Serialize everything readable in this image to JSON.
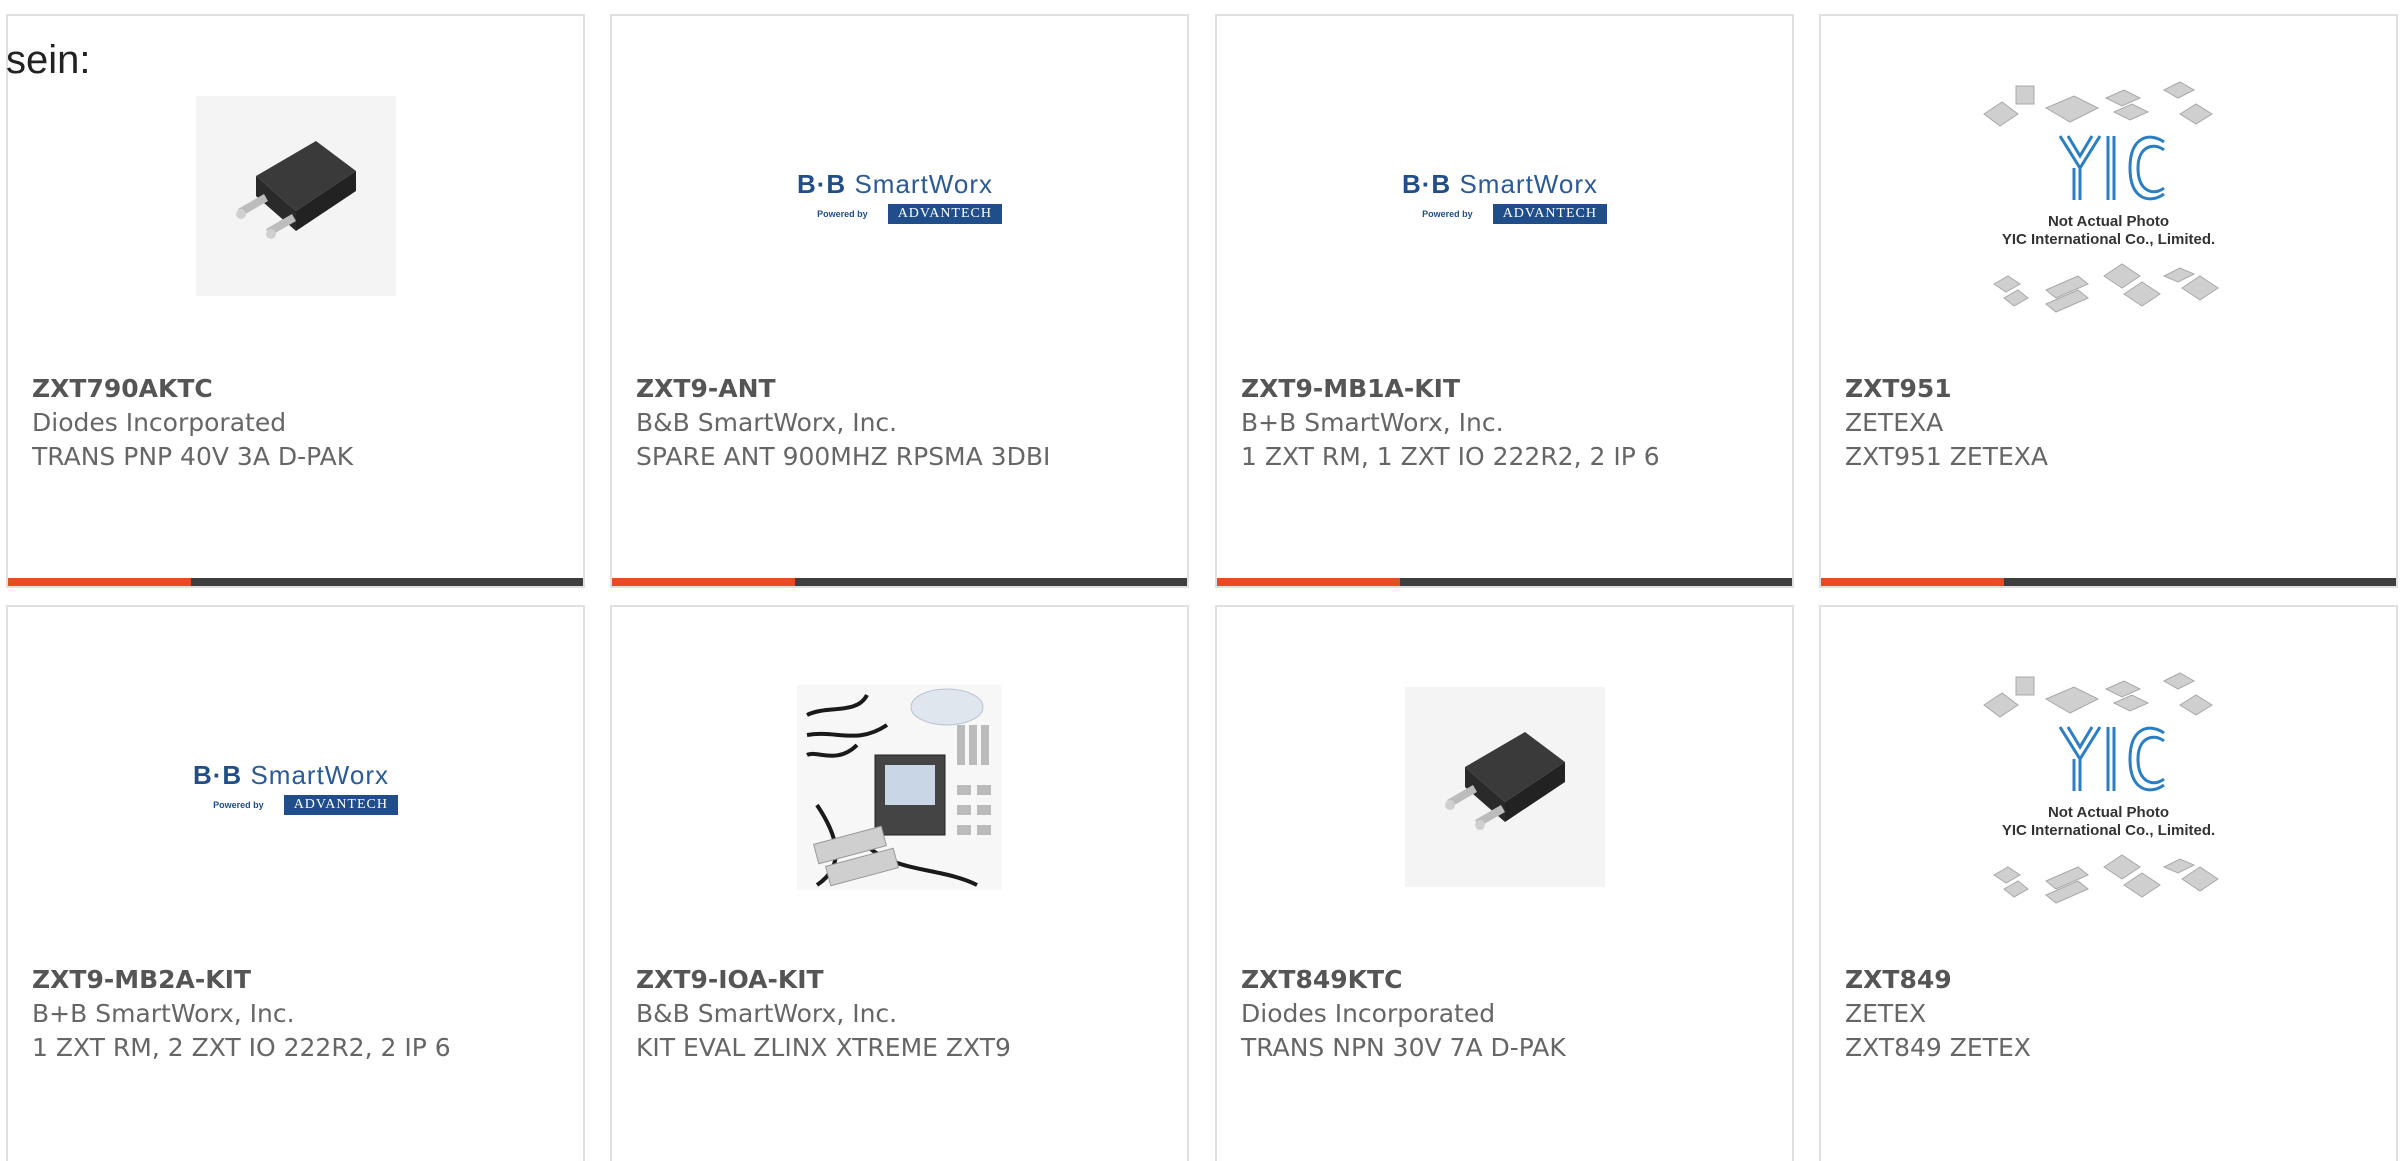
{
  "lead_text": "sein:",
  "products": [
    {
      "part_number": "ZXT790AKTC",
      "manufacturer": "Diodes Incorporated",
      "description": "TRANS PNP 40V 3A D-PAK",
      "image": "dpak-transistor-icon",
      "has_accent_bar": true
    },
    {
      "part_number": "ZXT9-ANT",
      "manufacturer": "B&B SmartWorx, Inc.",
      "description": "SPARE ANT 900MHZ RPSMA 3DBI",
      "image": "bb-smartworx-logo",
      "has_accent_bar": true
    },
    {
      "part_number": "ZXT9-MB1A-KIT",
      "manufacturer": "B+B SmartWorx, Inc.",
      "description": "1 ZXT RM, 1 ZXT IO 222R2, 2 IP 6",
      "image": "bb-smartworx-logo",
      "has_accent_bar": true
    },
    {
      "part_number": "ZXT951",
      "manufacturer": "ZETEXA",
      "description": "ZXT951 ZETEXA",
      "image": "yic-placeholder",
      "has_accent_bar": true
    },
    {
      "part_number": "ZXT9-MB2A-KIT",
      "manufacturer": "B+B SmartWorx, Inc.",
      "description": "1 ZXT RM, 2 ZXT IO 222R2, 2 IP 6",
      "image": "bb-smartworx-logo",
      "has_accent_bar": false
    },
    {
      "part_number": "ZXT9-IOA-KIT",
      "manufacturer": "B&B SmartWorx, Inc.",
      "description": "KIT EVAL ZLINX XTREME ZXT9",
      "image": "eval-kit-photo",
      "has_accent_bar": false
    },
    {
      "part_number": "ZXT849KTC",
      "manufacturer": "Diodes Incorporated",
      "description": "TRANS NPN 30V 7A D-PAK",
      "image": "dpak-transistor-icon",
      "has_accent_bar": false
    },
    {
      "part_number": "ZXT849",
      "manufacturer": "ZETEX",
      "description": "ZXT849 ZETEX",
      "image": "yic-placeholder",
      "has_accent_bar": false
    }
  ],
  "logos": {
    "bb_brand_left": "B·B",
    "bb_brand_right": "SmartWorx",
    "powered_by": "Powered by",
    "advantech": "ADVANTECH",
    "yic_line1": "Not Actual Photo",
    "yic_line2": "YIC International Co., Limited."
  },
  "colors": {
    "accent": "#e84b1f",
    "bar_dark": "#3e3e3e",
    "card_border": "#e0e0e0",
    "brand_blue": "#1f4e8a"
  }
}
